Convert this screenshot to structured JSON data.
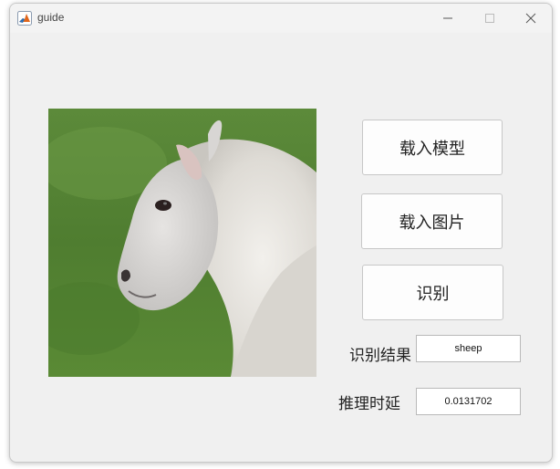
{
  "window": {
    "title": "guide",
    "app_icon": "matlab-icon",
    "controls": [
      "minimize-icon",
      "maximize-icon",
      "close-icon"
    ]
  },
  "image_panel": {
    "content": "sheep-photo"
  },
  "buttons": {
    "load_model": "载入模型",
    "load_image": "载入图片",
    "recognize": "识别"
  },
  "result": {
    "label": "识别结果",
    "value": "sheep"
  },
  "latency": {
    "label": "推理时延",
    "value": "0.0131702"
  }
}
